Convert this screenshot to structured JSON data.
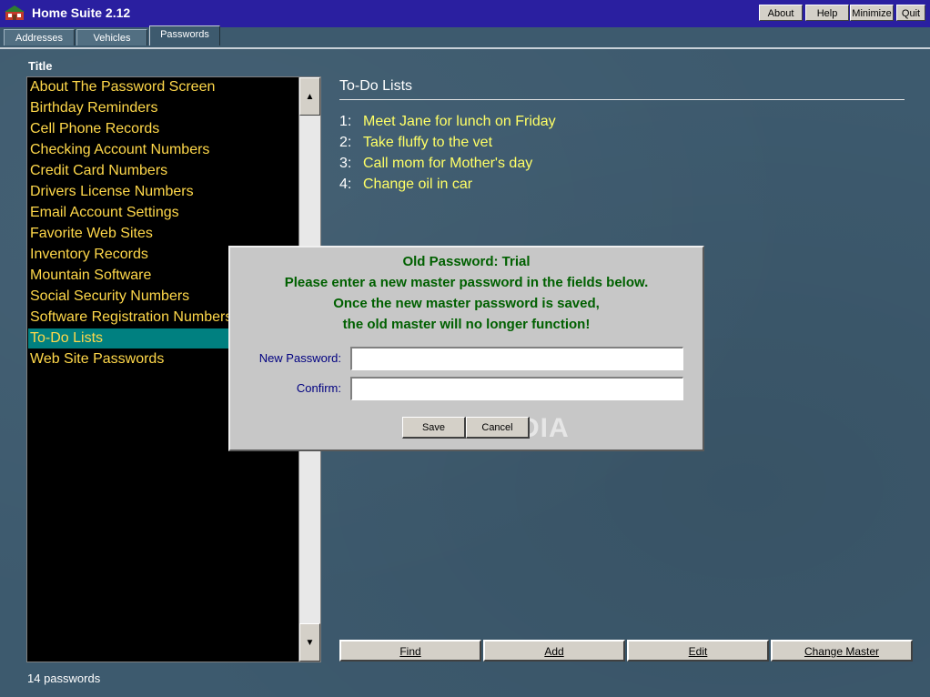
{
  "window": {
    "title": "Home Suite 2.12",
    "buttons": [
      "About",
      "Help",
      "Minimize",
      "Quit"
    ]
  },
  "tabs": [
    {
      "label": "Addresses",
      "active": false
    },
    {
      "label": "Vehicles",
      "active": false
    },
    {
      "label": "Passwords",
      "active": true
    }
  ],
  "list": {
    "header": "Title",
    "items": [
      "About The Password Screen",
      "Birthday Reminders",
      "Cell Phone Records",
      "Checking Account Numbers",
      "Credit Card Numbers",
      "Drivers License Numbers",
      "Email Account Settings",
      "Favorite Web Sites",
      "Inventory Records",
      "Mountain Software",
      "Social Security Numbers",
      "Software Registration Numbers",
      "To-Do Lists",
      "Web Site Passwords"
    ],
    "selected_index": 12,
    "status": "14 passwords"
  },
  "detail": {
    "title": "To-Do Lists",
    "items": [
      {
        "num": "1:",
        "text": "Meet Jane for lunch on Friday"
      },
      {
        "num": "2:",
        "text": "Take fluffy to the vet"
      },
      {
        "num": "3:",
        "text": "Call mom for Mother's day"
      },
      {
        "num": "4:",
        "text": "Change oil in car"
      }
    ]
  },
  "actions": [
    "Find",
    "Add",
    "Edit",
    "Change Master"
  ],
  "dialog": {
    "lines": [
      "Old Password: Trial",
      "Please enter a new master password in the fields below.",
      "Once the new master password is saved,",
      "the old master will no longer function!"
    ],
    "new_password_label": "New Password:",
    "new_password_value": "",
    "confirm_label": "Confirm:",
    "confirm_value": "",
    "save_label": "Save",
    "cancel_label": "Cancel",
    "watermark": "SOFTPEDIA"
  },
  "colors": {
    "background": "#3d5a6e",
    "titlebar": "#2a1fa0",
    "list_text": "#ffd84a",
    "selection": "#008080",
    "todo_text": "#ffff66",
    "dialog_text": "#006000"
  }
}
